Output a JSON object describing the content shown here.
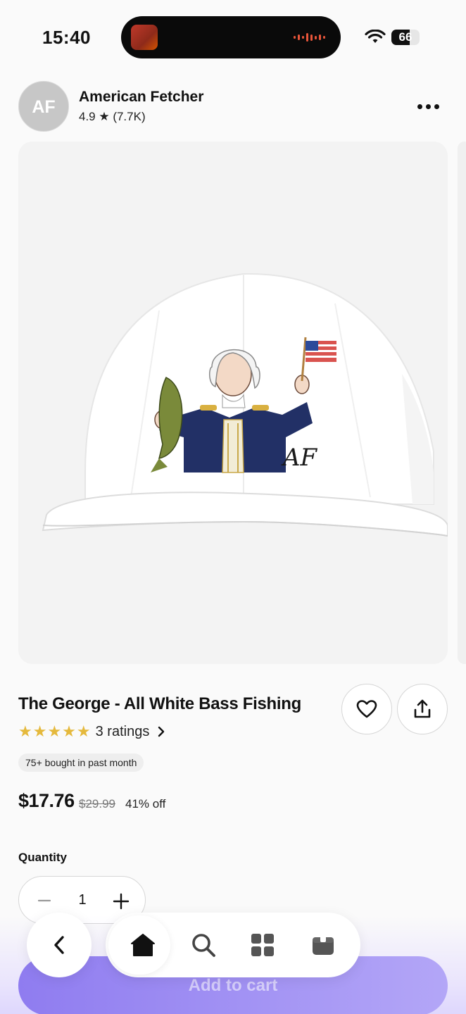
{
  "status_bar": {
    "time": "15:40",
    "battery": "66",
    "battery_level": 0.66
  },
  "shop": {
    "avatar_initials": "AF",
    "name": "American Fetcher",
    "rating": "4.9 ★ (7.7K)"
  },
  "product": {
    "title": "The George - All White Bass Fishing",
    "stars": "★★★★★",
    "stars_value": 5,
    "ratings_label": "3 ratings",
    "bought_badge": "75+ bought in past month",
    "price": "$17.76",
    "original_price": "$29.99",
    "discount": "41% off",
    "image_logo_text": "AF"
  },
  "quantity": {
    "label": "Quantity",
    "value": "1"
  },
  "cart": {
    "button_label": "Add to cart"
  },
  "icons": {
    "more": "more-horizontal-icon",
    "favorite": "heart-icon",
    "share": "share-icon",
    "back": "chevron-left-icon",
    "home": "home-icon",
    "search": "search-icon",
    "categories": "grid-icon",
    "orders": "package-icon"
  },
  "colors": {
    "star": "#e5b93c",
    "cart_button": "#8f7cf0",
    "background": "#fafafa"
  }
}
